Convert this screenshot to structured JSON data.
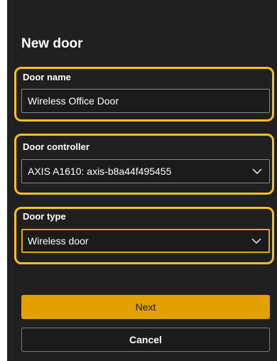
{
  "dialog": {
    "title": "New door",
    "door_name": {
      "label": "Door name",
      "value": "Wireless Office Door"
    },
    "door_controller": {
      "label": "Door controller",
      "selected": "AXIS A1610: axis-b8a44f495455"
    },
    "door_type": {
      "label": "Door type",
      "selected": "Wireless door"
    },
    "buttons": {
      "next": "Next",
      "cancel": "Cancel"
    },
    "colors": {
      "background": "#202020",
      "accent": "#e2a100",
      "highlight": "#f5c020"
    }
  }
}
